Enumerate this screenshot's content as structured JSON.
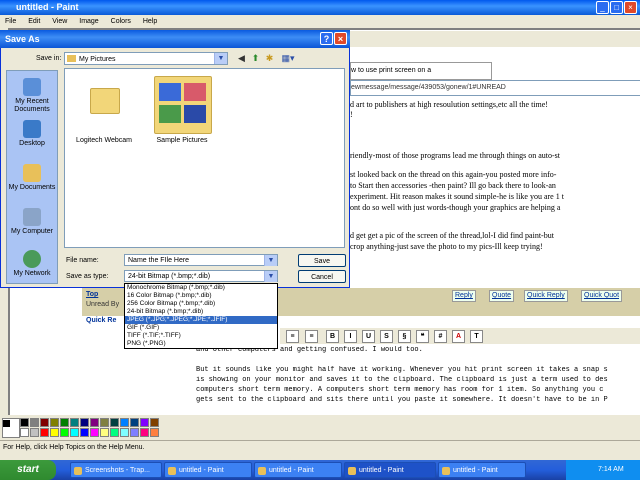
{
  "paint": {
    "title": "untitled - Paint",
    "menu": [
      "File",
      "Edit",
      "View",
      "Image",
      "Colors",
      "Help"
    ],
    "status": "For Help, click Help Topics on the Help Menu."
  },
  "browser": {
    "tab": "w to use print screen on a",
    "address": "ewmessage/message/439053/gonew/1#UNREAD",
    "lines": [
      "d art to publishers at high resoulution settings,etc all the time!",
      "!",
      "riendly-most of those programs lead me through things on auto-st",
      "st looked back on the thread on this again-you posted more info-",
      "to Start then accessories -then paint? Ill go back there to look-an",
      "experiment. Hit reason makes it sound simple-he is like you are 1 t",
      "ont do so well with just words-though your graphics are helping a",
      "d get get a pic of the screen of the thread,lol-I did find paint-but",
      "crop anything-just save the photo to my pics-Ill keep trying!"
    ],
    "top_link": "Top",
    "unread": "Unread By",
    "reply_buttons": [
      "Reply",
      "Quote",
      "Quick Reply",
      "Quick Quot"
    ],
    "quick_label": "Quick Re",
    "editor_buttons": [
      "B",
      "I",
      "U",
      "S",
      "§",
      "❝",
      "#",
      "A",
      "T"
    ],
    "reply_lines": [
      "and other computers and getting confused.  I would too.",
      "",
      "But it sounds like you might half have it working.  Whenever you hit print screen it takes a snap s",
      "is showing on your monitor and saves it to the clipboard.  The clipboard is just a term used to des",
      "computers short term memory.  A computers short term memory has room for 1 item.  So anything you c",
      "gets sent to the clipboard and sits there until you paste it somewhere.  It doesn't have to be in P"
    ]
  },
  "dialog": {
    "title": "Save As",
    "save_in_label": "Save in:",
    "save_in_value": "My Pictures",
    "places": [
      "My Recent Documents",
      "Desktop",
      "My Documents",
      "My Computer",
      "My Network"
    ],
    "files": [
      "Logitech Webcam",
      "Sample Pictures"
    ],
    "filename_label": "File name:",
    "filename_value": "Name the FIle Here",
    "savetype_label": "Save as type:",
    "savetype_value": "24-bit Bitmap (*.bmp;*.dib)",
    "save_btn": "Save",
    "cancel_btn": "Cancel",
    "type_options": [
      "Monochrome Bitmap (*.bmp;*.dib)",
      "16 Color Bitmap (*.bmp;*.dib)",
      "256 Color Bitmap (*.bmp;*.dib)",
      "24-bit Bitmap (*.bmp;*.dib)",
      "JPEG (*.JPG;*.JPEG;*.JPE;*.JFIF)",
      "GIF (*.GIF)",
      "TIFF (*.TIF;*.TIFF)",
      "PNG (*.PNG)"
    ],
    "selected_option_index": 4
  },
  "taskbar": {
    "start": "start",
    "tasks": [
      "Screenshots - Trap...",
      "untitled - Paint",
      "untitled - Paint",
      "untitled - Paint",
      "untitled - Paint"
    ],
    "active_task_index": 3,
    "time": "7:14 AM"
  },
  "colors": {
    "palette": [
      "#000000",
      "#808080",
      "#800000",
      "#808000",
      "#008000",
      "#008080",
      "#000080",
      "#800080",
      "#808040",
      "#004040",
      "#0080ff",
      "#004080",
      "#8000ff",
      "#804000",
      "#ffffff",
      "#c0c0c0",
      "#ff0000",
      "#ffff00",
      "#00ff00",
      "#00ffff",
      "#0000ff",
      "#ff00ff",
      "#ffff80",
      "#00ff80",
      "#80ffff",
      "#8080ff",
      "#ff0080",
      "#ff8040"
    ]
  }
}
